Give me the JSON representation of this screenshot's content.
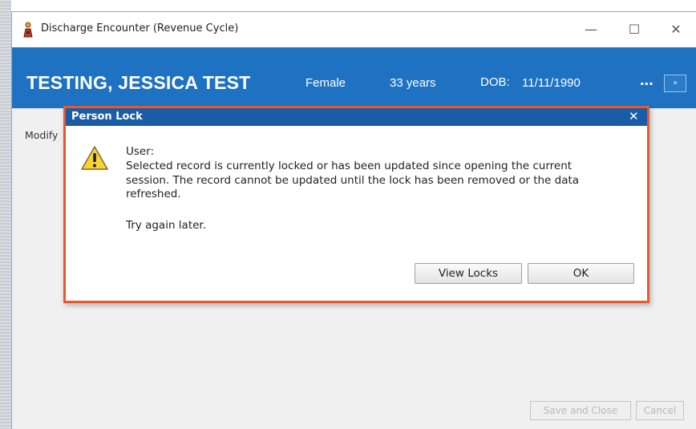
{
  "window": {
    "title": "Discharge Encounter (Revenue Cycle)",
    "minimize_glyph": "—",
    "maximize_glyph": "☐",
    "close_glyph": "✕",
    "app_icon": "person-icon"
  },
  "banner": {
    "patient_name": "TESTING, JESSICA TEST",
    "gender": "Female",
    "age": "33 years",
    "dob_label": "DOB:",
    "dob": "11/11/1990",
    "more": "...",
    "expand_glyph": "»",
    "color": "#1f72c2"
  },
  "body": {
    "modify_label": "Modify"
  },
  "footer": {
    "save_close_label": "Save and Close",
    "cancel_label": "Cancel"
  },
  "dialog": {
    "title": "Person Lock",
    "close_glyph": "✕",
    "icon": "warning-icon",
    "lines": [
      "User:",
      "Selected record is currently locked or has been updated since opening the current",
      "session.  The record cannot be updated until the lock has been removed or the data",
      "refreshed.",
      "Try again later."
    ],
    "view_locks_label": "View Locks",
    "ok_label": "OK",
    "border_color": "#e8582a",
    "title_color": "#1a5da6"
  }
}
